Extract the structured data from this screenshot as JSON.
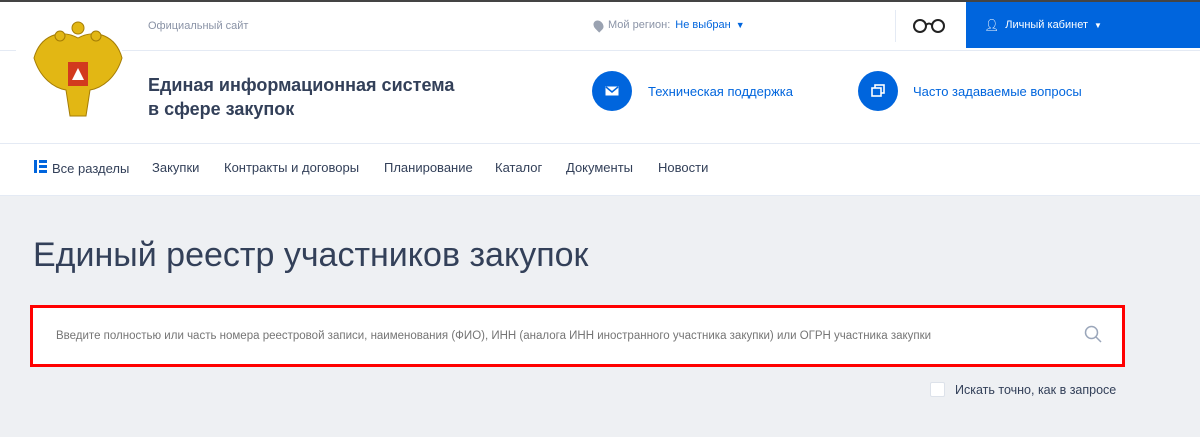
{
  "header": {
    "official": "Официальный сайт",
    "region_label": "Мой регион:",
    "region_value": "Не выбран",
    "cabinet": "Личный кабинет",
    "title_line1": "Единая информационная система",
    "title_line2": "в сфере закупок",
    "support": "Техническая поддержка",
    "faq": "Часто задаваемые вопросы"
  },
  "nav": [
    "Все разделы",
    "Закупки",
    "Контракты и договоры",
    "Планирование",
    "Каталог",
    "Документы",
    "Новости"
  ],
  "main": {
    "title": "Единый реестр участников закупок",
    "search_placeholder": "Введите полностью или часть номера реестровой записи, наименования (ФИО), ИНН (аналога ИНН иностранного участника закупки) или ОГРН участника закупки",
    "exact_label": "Искать точно, как в запросе"
  },
  "colors": {
    "accent": "#0065dd",
    "highlight": "#ff0000"
  }
}
